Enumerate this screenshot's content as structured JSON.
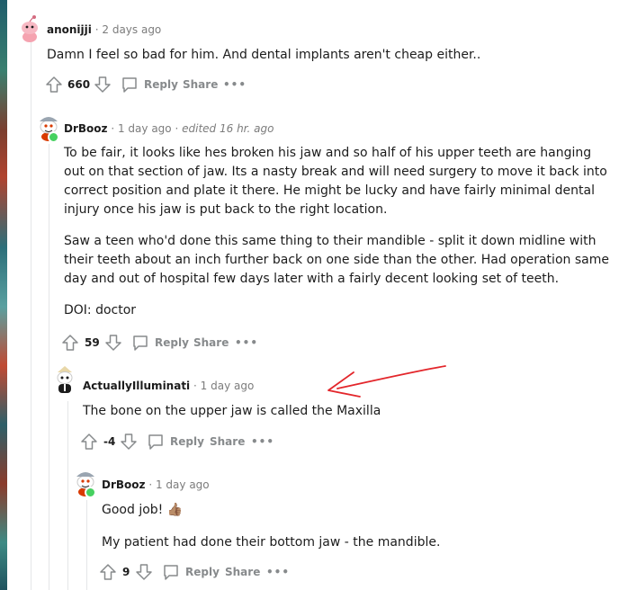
{
  "comments": [
    {
      "author": "anonijji",
      "sep": "·",
      "time": "2 days ago",
      "paragraphs": [
        "Damn I feel so bad for him. And dental implants aren't cheap either.."
      ],
      "score": "660",
      "reply_label": "Reply",
      "share_label": "Share",
      "more_label": "•••"
    },
    {
      "author": "DrBooz",
      "sep": "·",
      "time": "1 day ago",
      "sep2": "·",
      "edited": "edited 16 hr. ago",
      "paragraphs": [
        "To be fair, it looks like hes broken his jaw and so half of his upper teeth are hanging out on that section of jaw. Its a nasty break and will need surgery to move it back into correct position and plate it there. He might be lucky and have fairly minimal dental injury once his jaw is put back to the right location.",
        "Saw a teen who'd done this same thing to their mandible - split it down midline with their teeth about an inch further back on one side than the other. Had operation same day and out of hospital few days later with a fairly decent looking set of teeth.",
        "DOI: doctor"
      ],
      "score": "59",
      "reply_label": "Reply",
      "share_label": "Share",
      "more_label": "•••"
    },
    {
      "author": "ActuallyIlluminati",
      "sep": "·",
      "time": "1 day ago",
      "paragraphs": [
        "The bone on the upper jaw is called the Maxilla"
      ],
      "score": "-4",
      "reply_label": "Reply",
      "share_label": "Share",
      "more_label": "•••"
    },
    {
      "author": "DrBooz",
      "sep": "·",
      "time": "1 day ago",
      "paragraphs": [
        "Good job! 👍🏽",
        "My patient had done their bottom jaw - the mandible."
      ],
      "score": "9",
      "reply_label": "Reply",
      "share_label": "Share",
      "more_label": "•••"
    }
  ],
  "colors": {
    "text": "#1c1c1c",
    "meta": "#7c7c7c",
    "action": "#878a8c",
    "online": "#46d160",
    "annotation_arrow": "#e3262b"
  }
}
